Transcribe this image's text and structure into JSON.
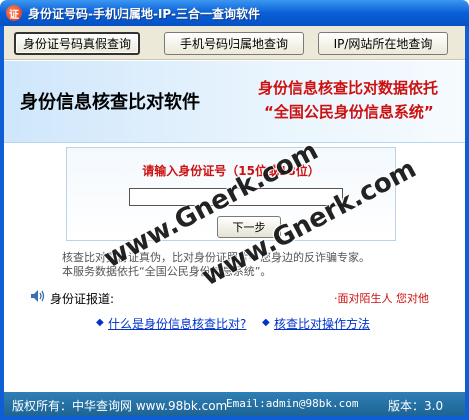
{
  "window": {
    "title": "身份证号码-手机归属地-IP-三合一查询软件",
    "icon_label": "证"
  },
  "toolbar": {
    "tabs": [
      {
        "label": "身份证号码真假查询",
        "active": true
      },
      {
        "label": "手机号码归属地查询",
        "active": false
      },
      {
        "label": "IP/网站所在地查询",
        "active": false
      }
    ]
  },
  "banner": {
    "title": "身份信息核查比对软件",
    "right_line1": "身份信息核查比对数据依托",
    "right_line2": "“全国公民身份信息系统”"
  },
  "form": {
    "prompt": "请输入身份证号（15位或18位）",
    "id_value": "",
    "next_label": "下一步"
  },
  "description": {
    "line1": "核查比对身份证真伪，比对身份证照片—您身边的反诈骗专家。",
    "line2": "本服务数据依托“全国公民身份信息系统”。"
  },
  "address": {
    "label": "身份证报道:",
    "value": "",
    "warning": "·面对陌生人 您对他"
  },
  "links": {
    "what": "什么是身份信息核查比对?",
    "how": "核查比对操作方法"
  },
  "statusbar": {
    "copyright": "版权所有：中华查询网 www.98bk.com",
    "email": "Email:admin@98bk.com",
    "version": "版本：3.0"
  },
  "watermark": {
    "text": "www.Gnerk.com"
  },
  "colors": {
    "titlebar": "#0a5fd6",
    "accent_red": "#cc1111",
    "link": "#0033cc",
    "status": "#2f7fb5"
  },
  "icons": {
    "app": "app-icon",
    "speaker": "speaker-icon"
  }
}
